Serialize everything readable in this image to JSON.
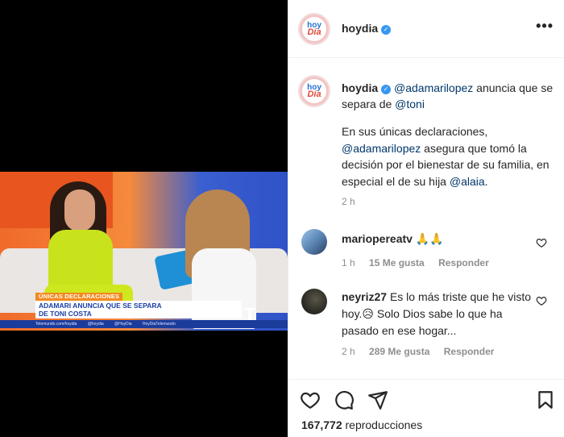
{
  "post": {
    "username": "hoydia",
    "avatar_text_top": "hoy",
    "avatar_text_bottom": "Día",
    "more_label": "•••"
  },
  "caption": {
    "username": "hoydia",
    "line1_mention": "@adamarilopez",
    "line1_rest": " anuncia que se separa de ",
    "line1_mention2": "@toni",
    "p2_start": "En sus únicas declaraciones, ",
    "p2_mention": "@adamarilopez",
    "p2_mid": " asegura que tomó la decisión por el bienestar de su familia, en especial el de su hija ",
    "p2_mention2": "@alaia",
    "p2_end": ".",
    "time": "2 h"
  },
  "comments": [
    {
      "username": "mariopereatv",
      "text": "🙏🙏",
      "time": "1 h",
      "likes": "15 Me gusta",
      "reply": "Responder"
    },
    {
      "username": "neyriz27",
      "text": "Es lo más triste que he visto hoy.😥 Solo Dios sabe lo que ha pasado en ese hogar...",
      "time": "2 h",
      "likes": "289 Me gusta",
      "reply": "Responder"
    }
  ],
  "actions": {
    "views_count": "167,772",
    "views_label": " reproducciones"
  },
  "video": {
    "tag": "ÚNICAS DECLARACIONES",
    "headline_line1": "ADAMARI ANUNCIA QUE SE SEPARA",
    "headline_line2": "DE TONI COSTA",
    "ticker": [
      "Telemundo.com/hoydia",
      "@hoydia",
      "@HoyDia",
      "HoyDiaTelemundo"
    ],
    "logo_letter": "T",
    "logo_sub": "TELEMUNDO"
  },
  "colors": {
    "verified": "#3897f0",
    "mention": "#00376b",
    "meta": "#8e8e8e",
    "lower_third_blue": "#1c3c9c",
    "tag_orange": "#f28a1f"
  }
}
